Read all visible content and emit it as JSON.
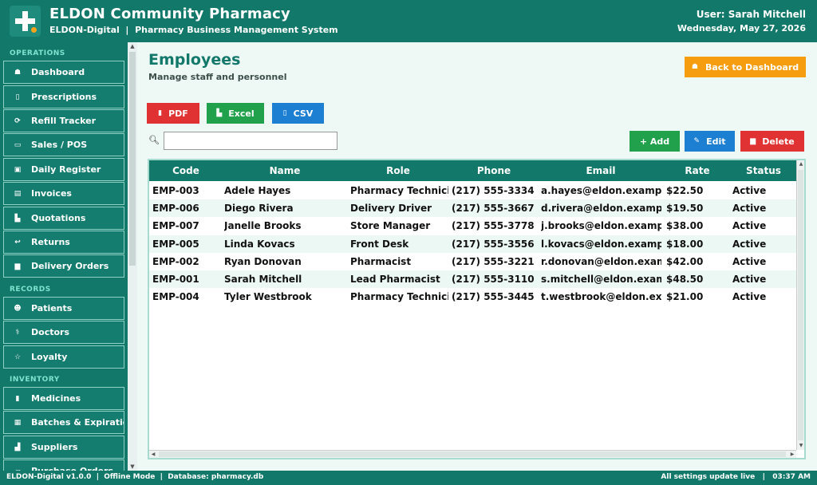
{
  "header": {
    "title": "ELDON Community Pharmacy",
    "subtitle": "ELDON-Digital  |  Pharmacy Business Management System",
    "user": "User: Sarah Mitchell",
    "date": "Wednesday, May 27, 2026"
  },
  "sidebar": {
    "sections": [
      {
        "label": "OPERATIONS"
      },
      {
        "label": "RECORDS"
      },
      {
        "label": "INVENTORY"
      }
    ],
    "items": [
      {
        "label": "Dashboard",
        "icon": "home-icon",
        "glyph": "☗"
      },
      {
        "label": "Prescriptions",
        "icon": "clipboard-icon",
        "glyph": "▯"
      },
      {
        "label": "Refill Tracker",
        "icon": "refresh-icon",
        "glyph": "⟳"
      },
      {
        "label": "Sales / POS",
        "icon": "card-icon",
        "glyph": "▭"
      },
      {
        "label": "Daily Register",
        "icon": "register-icon",
        "glyph": "▣"
      },
      {
        "label": "Invoices",
        "icon": "invoice-icon",
        "glyph": "▤"
      },
      {
        "label": "Quotations",
        "icon": "quote-icon",
        "glyph": "▙"
      },
      {
        "label": "Returns",
        "icon": "return-icon",
        "glyph": "↩"
      },
      {
        "label": "Delivery Orders",
        "icon": "truck-icon",
        "glyph": "▆"
      },
      {
        "label": "Patients",
        "icon": "people-icon",
        "glyph": "☻"
      },
      {
        "label": "Doctors",
        "icon": "stethoscope-icon",
        "glyph": "⚕"
      },
      {
        "label": "Loyalty",
        "icon": "star-icon",
        "glyph": "☆"
      },
      {
        "label": "Medicines",
        "icon": "pill-bottle-icon",
        "glyph": "▮"
      },
      {
        "label": "Batches & Expiration",
        "icon": "boxes-icon",
        "glyph": "▦"
      },
      {
        "label": "Suppliers",
        "icon": "factory-icon",
        "glyph": "▟"
      },
      {
        "label": "Purchase Orders",
        "icon": "cart-icon",
        "glyph": "▱"
      }
    ]
  },
  "main": {
    "title": "Employees",
    "subtitle": "Manage staff and personnel",
    "back_label": "Back to Dashboard",
    "export": {
      "pdf": "PDF",
      "excel": "Excel",
      "csv": "CSV"
    },
    "actions": {
      "add": "+ Add",
      "edit": "Edit",
      "delete": "Delete"
    },
    "search": {
      "value": "",
      "placeholder": ""
    }
  },
  "table": {
    "columns": [
      "Code",
      "Name",
      "Role",
      "Phone",
      "Email",
      "Rate",
      "Status"
    ],
    "rows": [
      [
        "EMP-003",
        "Adele Hayes",
        "Pharmacy Technician",
        "(217) 555-3334",
        "a.hayes@eldon.example",
        "$22.50",
        "Active"
      ],
      [
        "EMP-006",
        "Diego Rivera",
        "Delivery Driver",
        "(217) 555-3667",
        "d.rivera@eldon.example",
        "$19.50",
        "Active"
      ],
      [
        "EMP-007",
        "Janelle Brooks",
        "Store Manager",
        "(217) 555-3778",
        "j.brooks@eldon.example",
        "$38.00",
        "Active"
      ],
      [
        "EMP-005",
        "Linda Kovacs",
        "Front Desk",
        "(217) 555-3556",
        "l.kovacs@eldon.example",
        "$18.00",
        "Active"
      ],
      [
        "EMP-002",
        "Ryan Donovan",
        "Pharmacist",
        "(217) 555-3221",
        "r.donovan@eldon.example",
        "$42.00",
        "Active"
      ],
      [
        "EMP-001",
        "Sarah Mitchell",
        "Lead Pharmacist",
        "(217) 555-3110",
        "s.mitchell@eldon.example",
        "$48.50",
        "Active"
      ],
      [
        "EMP-004",
        "Tyler Westbrook",
        "Pharmacy Technician",
        "(217) 555-3445",
        "t.westbrook@eldon.example",
        "$21.00",
        "Active"
      ]
    ]
  },
  "statusbar": {
    "left": "ELDON-Digital v1.0.0  |  Offline Mode  |  Database: pharmacy.db",
    "right": "All settings update live   |   03:37 AM"
  },
  "colors": {
    "primary": "#12786a",
    "accent_orange": "#f59d0e",
    "pdf_red": "#e03232",
    "excel_green": "#21a14b",
    "csv_blue": "#1d7fd1",
    "add_green": "#21a14b",
    "edit_blue": "#1d7fd1",
    "delete_red": "#e03232"
  }
}
